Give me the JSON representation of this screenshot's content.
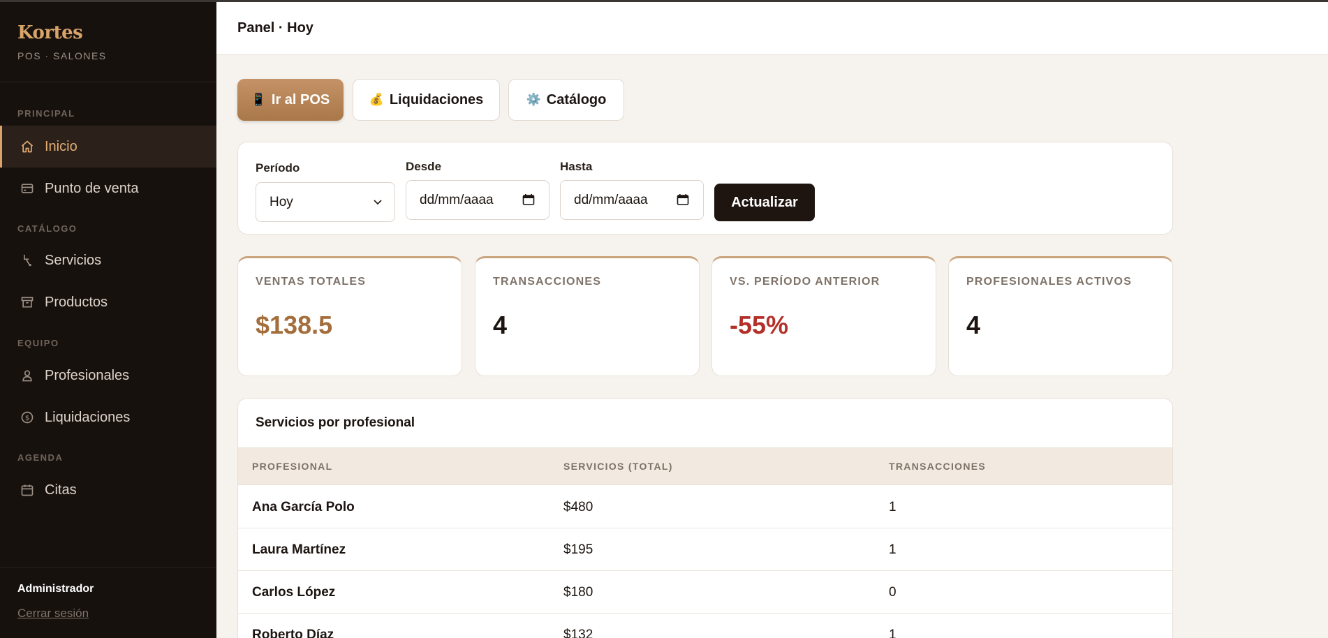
{
  "brand": {
    "name": "Kortes",
    "subtitle": "POS · SALONES"
  },
  "sidebar": {
    "sections": {
      "principal": "PRINCIPAL",
      "catalogo": "CATÁLOGO",
      "equipo": "EQUIPO",
      "agenda": "AGENDA"
    },
    "items": [
      {
        "label": "Inicio",
        "icon": "home-icon",
        "active": true
      },
      {
        "label": "Punto de venta",
        "icon": "credit-card-icon"
      },
      {
        "label": "Servicios",
        "icon": "scissors-icon"
      },
      {
        "label": "Productos",
        "icon": "archive-box-icon"
      },
      {
        "label": "Profesionales",
        "icon": "user-icon"
      },
      {
        "label": "Liquidaciones",
        "icon": "dollar-circle-icon"
      },
      {
        "label": "Citas",
        "icon": "calendar-icon"
      }
    ],
    "footer": {
      "user": "Administrador",
      "logout": "Cerrar sesión"
    }
  },
  "header": {
    "title": "Panel · Hoy"
  },
  "actions": {
    "pos": {
      "label": "Ir al POS",
      "icon": "📱"
    },
    "liquidaciones": {
      "label": "Liquidaciones",
      "icon": "💰"
    },
    "catalogo": {
      "label": "Catálogo",
      "icon": "⚙️"
    }
  },
  "filters": {
    "periodo": {
      "label": "Período",
      "value": "Hoy"
    },
    "desde": {
      "label": "Desde",
      "placeholder": "dd/mm/aaaa"
    },
    "hasta": {
      "label": "Hasta",
      "placeholder": "dd/mm/aaaa"
    },
    "submit": "Actualizar"
  },
  "stats": [
    {
      "label": "VENTAS TOTALES",
      "value": "$138.5",
      "color": "#a36e3c"
    },
    {
      "label": "TRANSACCIONES",
      "value": "4",
      "color": "#1c1410"
    },
    {
      "label": "VS. PERÍODO ANTERIOR",
      "value": "-55%",
      "color": "#b3302a"
    },
    {
      "label": "PROFESIONALES ACTIVOS",
      "value": "4",
      "color": "#1c1410"
    }
  ],
  "table": {
    "title": "Servicios por profesional",
    "columns": [
      "PROFESIONAL",
      "SERVICIOS (TOTAL)",
      "TRANSACCIONES"
    ],
    "rows": [
      [
        "Ana García Polo",
        "$480",
        "1"
      ],
      [
        "Laura Martínez",
        "$195",
        "1"
      ],
      [
        "Carlos López",
        "$180",
        "0"
      ],
      [
        "Roberto Díaz",
        "$132",
        "1"
      ]
    ]
  },
  "colors": {
    "accent": "#d9a46a",
    "sidebar_bg": "#17110e",
    "primary_btn": "#b4845a",
    "dark_btn": "#1e1511",
    "negative": "#b3302a"
  }
}
